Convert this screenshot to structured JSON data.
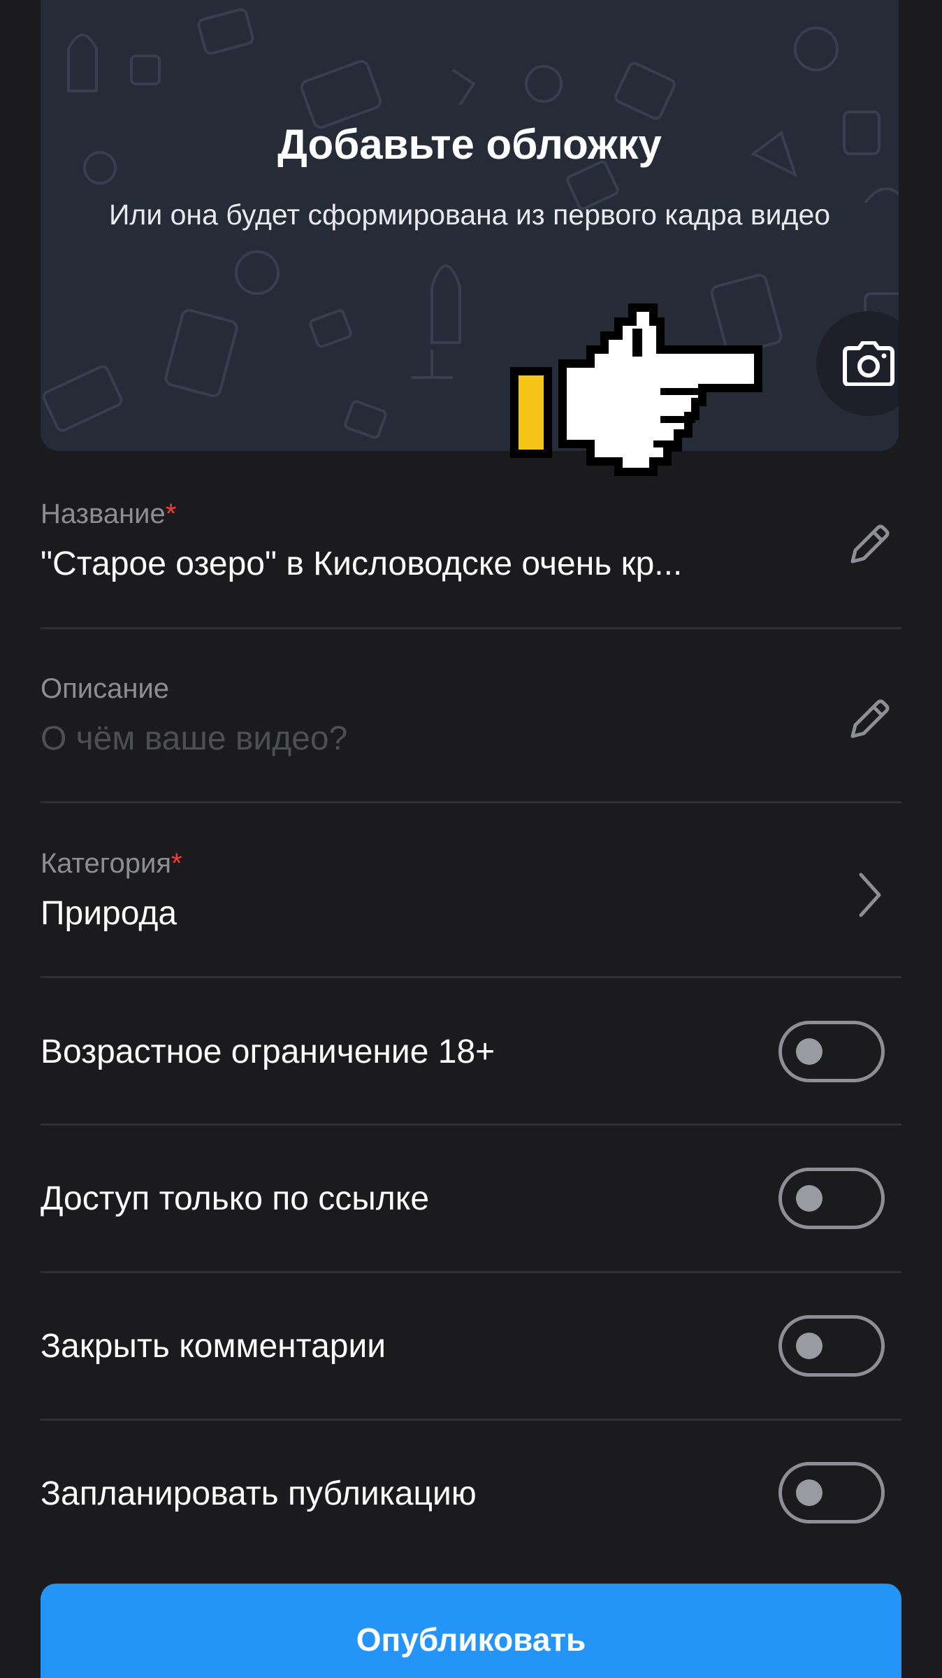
{
  "cover": {
    "title": "Добавьте обложку",
    "subtitle": "Или она будет сформирована из первого кадра видео",
    "camera_icon": "camera-icon"
  },
  "form": {
    "title_field": {
      "label": "Название",
      "required_mark": "*",
      "value": "\"Старое озеро\" в Кисловодске очень кр...",
      "icon": "pencil-icon"
    },
    "description_field": {
      "label": "Описание",
      "placeholder": "О чём ваше видео?",
      "icon": "pencil-icon"
    },
    "category_field": {
      "label": "Категория",
      "required_mark": "*",
      "value": "Природа",
      "icon": "chevron-right-icon"
    }
  },
  "toggles": [
    {
      "label": "Возрастное ограничение 18+",
      "on": false
    },
    {
      "label": "Доступ только по ссылке",
      "on": false
    },
    {
      "label": "Закрыть комментарии",
      "on": false
    },
    {
      "label": "Запланировать публикацию",
      "on": false
    }
  ],
  "publish_button": {
    "label": "Опубликовать"
  },
  "colors": {
    "background": "#1b1b1d",
    "cover_background": "#252b37",
    "accent": "#2495f7",
    "required": "#ff3b30",
    "hint_text": "#8d8e93"
  }
}
